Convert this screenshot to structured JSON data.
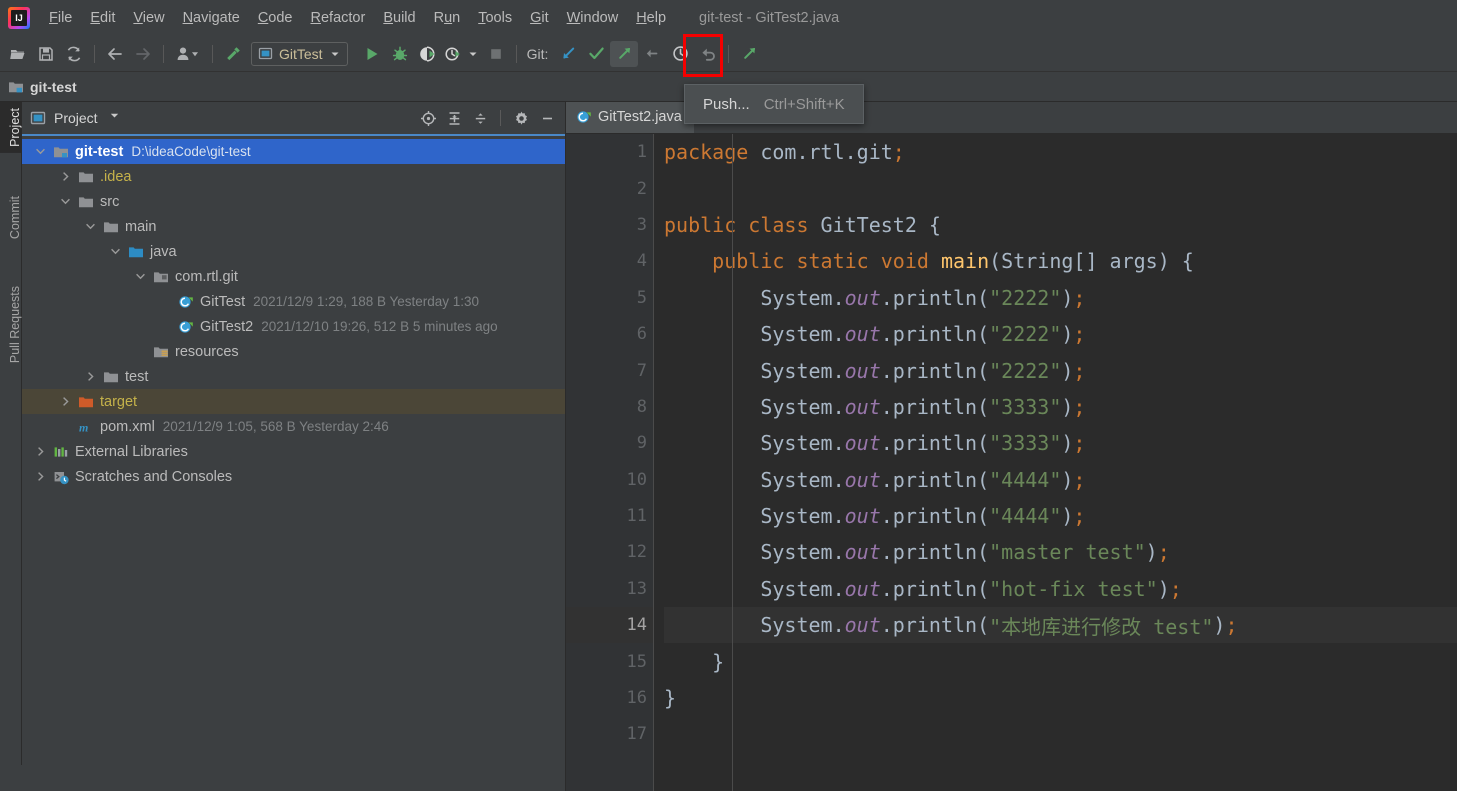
{
  "window": {
    "title": "git-test - GitTest2.java",
    "logo_icon": "intellij-idea-logo"
  },
  "menubar": {
    "items": [
      {
        "label": "File",
        "mnemonic": "F"
      },
      {
        "label": "Edit",
        "mnemonic": "E"
      },
      {
        "label": "View",
        "mnemonic": "V"
      },
      {
        "label": "Navigate",
        "mnemonic": "N"
      },
      {
        "label": "Code",
        "mnemonic": "C"
      },
      {
        "label": "Refactor",
        "mnemonic": "R"
      },
      {
        "label": "Build",
        "mnemonic": "B"
      },
      {
        "label": "Run",
        "mnemonic": "u"
      },
      {
        "label": "Tools",
        "mnemonic": "T"
      },
      {
        "label": "Git",
        "mnemonic": "G"
      },
      {
        "label": "Window",
        "mnemonic": "W"
      },
      {
        "label": "Help",
        "mnemonic": "H"
      }
    ]
  },
  "toolbar": {
    "open_icon": "open-folder-icon",
    "save_icon": "save-icon",
    "sync_icon": "sync-refresh-icon",
    "back_icon": "arrow-back-icon",
    "forward_icon": "arrow-forward-icon",
    "profile_icon": "user-profile-icon",
    "build_icon": "build-hammer-icon",
    "run_config_label": "GitTest",
    "run_config_icon": "run-configuration-icon",
    "run_icon": "run-icon",
    "debug_icon": "debug-icon",
    "coverage_icon": "run-with-coverage-icon",
    "profiler_icon": "profiler-icon",
    "stop_icon": "stop-icon",
    "git_label": "Git:",
    "update_icon": "git-update-project-icon",
    "commit_icon": "git-commit-checkmark-icon",
    "push_icon": "git-push-icon",
    "rebase_icon": "git-rebase-icon",
    "history_icon": "git-history-clock-icon",
    "rollback_icon": "git-rollback-undo-icon",
    "share_icon": "git-share-arrow-icon"
  },
  "highlight": {
    "color": "#f50000",
    "target": "git-push-toolbar-button"
  },
  "tooltip": {
    "label": "Push...",
    "shortcut": "Ctrl+Shift+K"
  },
  "navbar": {
    "crumb": "git-test",
    "icon": "module-folder-icon"
  },
  "tool_window_tabs": [
    {
      "label": "Project",
      "icon": "project-icon",
      "active": true
    },
    {
      "label": "Commit",
      "icon": "commit-icon",
      "active": false
    },
    {
      "label": "Pull Requests",
      "icon": "pull-requests-icon",
      "active": false
    }
  ],
  "project_panel": {
    "title": "Project",
    "title_icon": "project-view-icon",
    "dropdown_icon": "chevron-down-icon",
    "actions": [
      {
        "name": "select-opened-file-icon",
        "label": "Select Opened File"
      },
      {
        "name": "expand-all-icon",
        "label": "Expand All"
      },
      {
        "name": "collapse-all-icon",
        "label": "Collapse All"
      },
      {
        "name": "settings-gear-icon",
        "label": "Settings"
      },
      {
        "name": "hide-minimize-icon",
        "label": "Hide"
      }
    ],
    "tree": [
      {
        "depth": 0,
        "arrow": "down",
        "icon": "module-folder-icon",
        "name": "git-test",
        "meta": "D:\\ideaCode\\git-test",
        "state": "selected",
        "bold": true
      },
      {
        "depth": 1,
        "arrow": "right",
        "icon": "folder-icon",
        "name": ".idea",
        "meta": "",
        "state": "normal",
        "color": "yellow"
      },
      {
        "depth": 1,
        "arrow": "down",
        "icon": "folder-icon",
        "name": "src",
        "meta": "",
        "state": "normal"
      },
      {
        "depth": 2,
        "arrow": "down",
        "icon": "folder-icon",
        "name": "main",
        "meta": "",
        "state": "normal"
      },
      {
        "depth": 3,
        "arrow": "down",
        "icon": "source-root-folder-icon",
        "name": "java",
        "meta": "",
        "state": "normal"
      },
      {
        "depth": 4,
        "arrow": "down",
        "icon": "package-icon",
        "name": "com.rtl.git",
        "meta": "",
        "state": "normal"
      },
      {
        "depth": 5,
        "arrow": "none",
        "icon": "java-class-icon",
        "name": "GitTest",
        "meta": "2021/12/9 1:29, 188 B Yesterday 1:30",
        "state": "normal"
      },
      {
        "depth": 5,
        "arrow": "none",
        "icon": "java-class-icon",
        "name": "GitTest2",
        "meta": "2021/12/10 19:26, 512 B 5 minutes ago",
        "state": "normal"
      },
      {
        "depth": 4,
        "arrow": "none",
        "icon": "resources-folder-icon",
        "name": "resources",
        "meta": "",
        "state": "normal"
      },
      {
        "depth": 2,
        "arrow": "right",
        "icon": "folder-icon",
        "name": "test",
        "meta": "",
        "state": "normal"
      },
      {
        "depth": 1,
        "arrow": "right",
        "icon": "excluded-folder-icon",
        "name": "target",
        "meta": "",
        "state": "highlighted",
        "color": "yellow"
      },
      {
        "depth": 1,
        "arrow": "none",
        "icon": "maven-pom-icon",
        "name": "pom.xml",
        "meta": "2021/12/9 1:05, 568 B Yesterday 2:46",
        "state": "normal"
      },
      {
        "depth": 0,
        "arrow": "right",
        "icon": "external-libraries-icon",
        "name": "External Libraries",
        "meta": "",
        "state": "normal"
      },
      {
        "depth": 0,
        "arrow": "right",
        "icon": "scratches-consoles-icon",
        "name": "Scratches and Consoles",
        "meta": "",
        "state": "normal"
      }
    ]
  },
  "editor": {
    "tab": {
      "label": "GitTest2.java",
      "icon": "java-class-icon"
    },
    "current_line": 14,
    "total_lines": 17,
    "lines": [
      {
        "n": 1,
        "indent": 0,
        "run_marker": false,
        "fold": "none",
        "tokens": [
          {
            "t": "kw",
            "v": "package"
          },
          {
            "t": "plain",
            "v": " com.rtl.git"
          },
          {
            "t": "sem",
            "v": ";"
          }
        ]
      },
      {
        "n": 2,
        "indent": 0,
        "run_marker": false,
        "fold": "none",
        "tokens": []
      },
      {
        "n": 3,
        "indent": 0,
        "run_marker": true,
        "fold": "none",
        "tokens": [
          {
            "t": "kw",
            "v": "public class"
          },
          {
            "t": "plain",
            "v": " GitTest2 {"
          }
        ]
      },
      {
        "n": 4,
        "indent": 1,
        "run_marker": true,
        "fold": "start",
        "tokens": [
          {
            "t": "kw",
            "v": "public static void"
          },
          {
            "t": "plain",
            "v": " "
          },
          {
            "t": "mth",
            "v": "main"
          },
          {
            "t": "plain",
            "v": "(String[] args) {"
          }
        ]
      },
      {
        "n": 5,
        "indent": 2,
        "run_marker": false,
        "fold": "none",
        "tokens": [
          {
            "t": "plain",
            "v": "System."
          },
          {
            "t": "fld",
            "v": "out"
          },
          {
            "t": "plain",
            "v": ".println("
          },
          {
            "t": "str",
            "v": "\"2222\""
          },
          {
            "t": "plain",
            "v": ")"
          },
          {
            "t": "sem",
            "v": ";"
          }
        ]
      },
      {
        "n": 6,
        "indent": 2,
        "run_marker": false,
        "fold": "none",
        "tokens": [
          {
            "t": "plain",
            "v": "System."
          },
          {
            "t": "fld",
            "v": "out"
          },
          {
            "t": "plain",
            "v": ".println("
          },
          {
            "t": "str",
            "v": "\"2222\""
          },
          {
            "t": "plain",
            "v": ")"
          },
          {
            "t": "sem",
            "v": ";"
          }
        ]
      },
      {
        "n": 7,
        "indent": 2,
        "run_marker": false,
        "fold": "none",
        "tokens": [
          {
            "t": "plain",
            "v": "System."
          },
          {
            "t": "fld",
            "v": "out"
          },
          {
            "t": "plain",
            "v": ".println("
          },
          {
            "t": "str",
            "v": "\"2222\""
          },
          {
            "t": "plain",
            "v": ")"
          },
          {
            "t": "sem",
            "v": ";"
          }
        ]
      },
      {
        "n": 8,
        "indent": 2,
        "run_marker": false,
        "fold": "none",
        "tokens": [
          {
            "t": "plain",
            "v": "System."
          },
          {
            "t": "fld",
            "v": "out"
          },
          {
            "t": "plain",
            "v": ".println("
          },
          {
            "t": "str",
            "v": "\"3333\""
          },
          {
            "t": "plain",
            "v": ")"
          },
          {
            "t": "sem",
            "v": ";"
          }
        ]
      },
      {
        "n": 9,
        "indent": 2,
        "run_marker": false,
        "fold": "none",
        "tokens": [
          {
            "t": "plain",
            "v": "System."
          },
          {
            "t": "fld",
            "v": "out"
          },
          {
            "t": "plain",
            "v": ".println("
          },
          {
            "t": "str",
            "v": "\"3333\""
          },
          {
            "t": "plain",
            "v": ")"
          },
          {
            "t": "sem",
            "v": ";"
          }
        ]
      },
      {
        "n": 10,
        "indent": 2,
        "run_marker": false,
        "fold": "none",
        "tokens": [
          {
            "t": "plain",
            "v": "System."
          },
          {
            "t": "fld",
            "v": "out"
          },
          {
            "t": "plain",
            "v": ".println("
          },
          {
            "t": "str",
            "v": "\"4444\""
          },
          {
            "t": "plain",
            "v": ")"
          },
          {
            "t": "sem",
            "v": ";"
          }
        ]
      },
      {
        "n": 11,
        "indent": 2,
        "run_marker": false,
        "fold": "none",
        "tokens": [
          {
            "t": "plain",
            "v": "System."
          },
          {
            "t": "fld",
            "v": "out"
          },
          {
            "t": "plain",
            "v": ".println("
          },
          {
            "t": "str",
            "v": "\"4444\""
          },
          {
            "t": "plain",
            "v": ")"
          },
          {
            "t": "sem",
            "v": ";"
          }
        ]
      },
      {
        "n": 12,
        "indent": 2,
        "run_marker": false,
        "fold": "none",
        "tokens": [
          {
            "t": "plain",
            "v": "System."
          },
          {
            "t": "fld",
            "v": "out"
          },
          {
            "t": "plain",
            "v": ".println("
          },
          {
            "t": "str",
            "v": "\"master test\""
          },
          {
            "t": "plain",
            "v": ")"
          },
          {
            "t": "sem",
            "v": ";"
          }
        ]
      },
      {
        "n": 13,
        "indent": 2,
        "run_marker": false,
        "fold": "none",
        "tokens": [
          {
            "t": "plain",
            "v": "System."
          },
          {
            "t": "fld",
            "v": "out"
          },
          {
            "t": "plain",
            "v": ".println("
          },
          {
            "t": "str",
            "v": "\"hot-fix test\""
          },
          {
            "t": "plain",
            "v": ")"
          },
          {
            "t": "sem",
            "v": ";"
          }
        ]
      },
      {
        "n": 14,
        "indent": 2,
        "run_marker": false,
        "fold": "none",
        "tokens": [
          {
            "t": "plain",
            "v": "System."
          },
          {
            "t": "fld",
            "v": "out"
          },
          {
            "t": "plain",
            "v": ".println("
          },
          {
            "t": "str",
            "v": "\"本地库进行修改 test\""
          },
          {
            "t": "plain",
            "v": ")"
          },
          {
            "t": "sem",
            "v": ";"
          }
        ]
      },
      {
        "n": 15,
        "indent": 1,
        "run_marker": false,
        "fold": "end",
        "tokens": [
          {
            "t": "plain",
            "v": "}"
          }
        ]
      },
      {
        "n": 16,
        "indent": 0,
        "run_marker": false,
        "fold": "none",
        "tokens": [
          {
            "t": "plain",
            "v": "}"
          }
        ]
      },
      {
        "n": 17,
        "indent": 0,
        "run_marker": false,
        "fold": "none",
        "tokens": []
      }
    ]
  },
  "colors": {
    "panel_bg": "#3c3f41",
    "editor_bg": "#2b2b2b",
    "gutter_bg": "#313335",
    "selection_blue": "#2f65ca",
    "accent_underline": "#4a88c7",
    "keyword": "#cc7832",
    "string": "#6a8759",
    "field": "#9876aa",
    "method": "#ffc66d",
    "text": "#a9b7c6",
    "highlight_red": "#f50000",
    "target_row": "#4b4637"
  }
}
